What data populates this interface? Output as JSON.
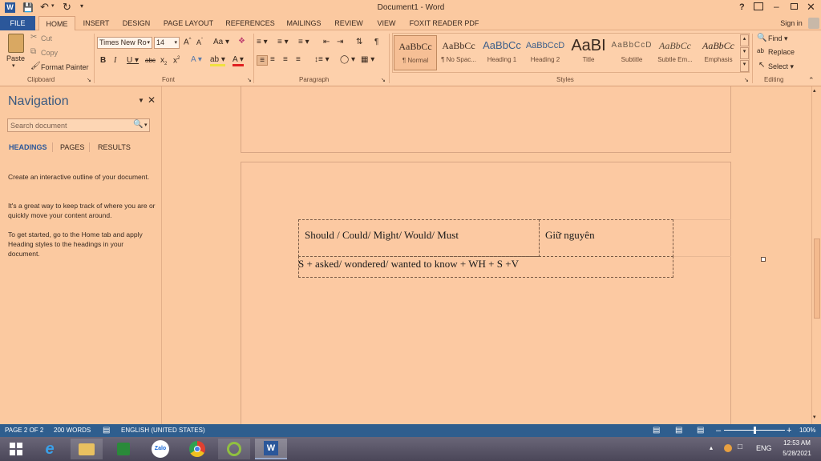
{
  "titlebar": {
    "title": "Document1 - Word",
    "help": "?",
    "sign_in": "Sign in"
  },
  "tabs": [
    {
      "label": "FILE"
    },
    {
      "label": "HOME"
    },
    {
      "label": "INSERT"
    },
    {
      "label": "DESIGN"
    },
    {
      "label": "PAGE LAYOUT"
    },
    {
      "label": "REFERENCES"
    },
    {
      "label": "MAILINGS"
    },
    {
      "label": "REVIEW"
    },
    {
      "label": "VIEW"
    },
    {
      "label": "FOXIT READER PDF"
    }
  ],
  "clipboard": {
    "paste": "Paste",
    "cut": "Cut",
    "copy": "Copy",
    "format_painter": "Format Painter",
    "group": "Clipboard"
  },
  "font": {
    "name": "Times New Ro",
    "size": "14",
    "group": "Font",
    "aa": "Aa"
  },
  "paragraph": {
    "group": "Paragraph"
  },
  "styles": {
    "group": "Styles",
    "items": [
      {
        "sample": "AaBbCc",
        "name": "¶ Normal"
      },
      {
        "sample": "AaBbCc",
        "name": "¶ No Spac..."
      },
      {
        "sample": "AaBbCc",
        "name": "Heading 1"
      },
      {
        "sample": "AaBbCcD",
        "name": "Heading 2"
      },
      {
        "sample": "AaBI",
        "name": "Title"
      },
      {
        "sample": "AaBbCcD",
        "name": "Subtitle"
      },
      {
        "sample": "AaBbCc",
        "name": "Subtle Em..."
      },
      {
        "sample": "AaBbCc",
        "name": "Emphasis"
      }
    ]
  },
  "editing": {
    "find": "Find",
    "replace": "Replace",
    "select": "Select",
    "group": "Editing"
  },
  "nav": {
    "title": "Navigation",
    "search_placeholder": "Search document",
    "tabs": [
      "HEADINGS",
      "PAGES",
      "RESULTS"
    ],
    "p1": "Create an interactive outline of your document.",
    "p2": "It's a great way to keep track of where you are or quickly move your content around.",
    "p3": "To get started, go to the Home tab and apply Heading styles to the headings in your document."
  },
  "document": {
    "cell_left": "Should / Could/ Might/ Would/ Must",
    "cell_right": "Giữ nguyên",
    "line": "S + asked/ wondered/ wanted to know + WH + S +V"
  },
  "status": {
    "page": "PAGE 2 OF 2",
    "words": "200 WORDS",
    "language": "ENGLISH (UNITED STATES)",
    "zoom": "100%",
    "zoom_level": 1.0
  },
  "taskbar": {
    "time": "12:53 AM",
    "date": "5/28/2021",
    "lang": "ENG",
    "zalo": "Zalo"
  },
  "colors": {
    "accent": "#2f5e8e",
    "background": "#fbc9a0"
  }
}
